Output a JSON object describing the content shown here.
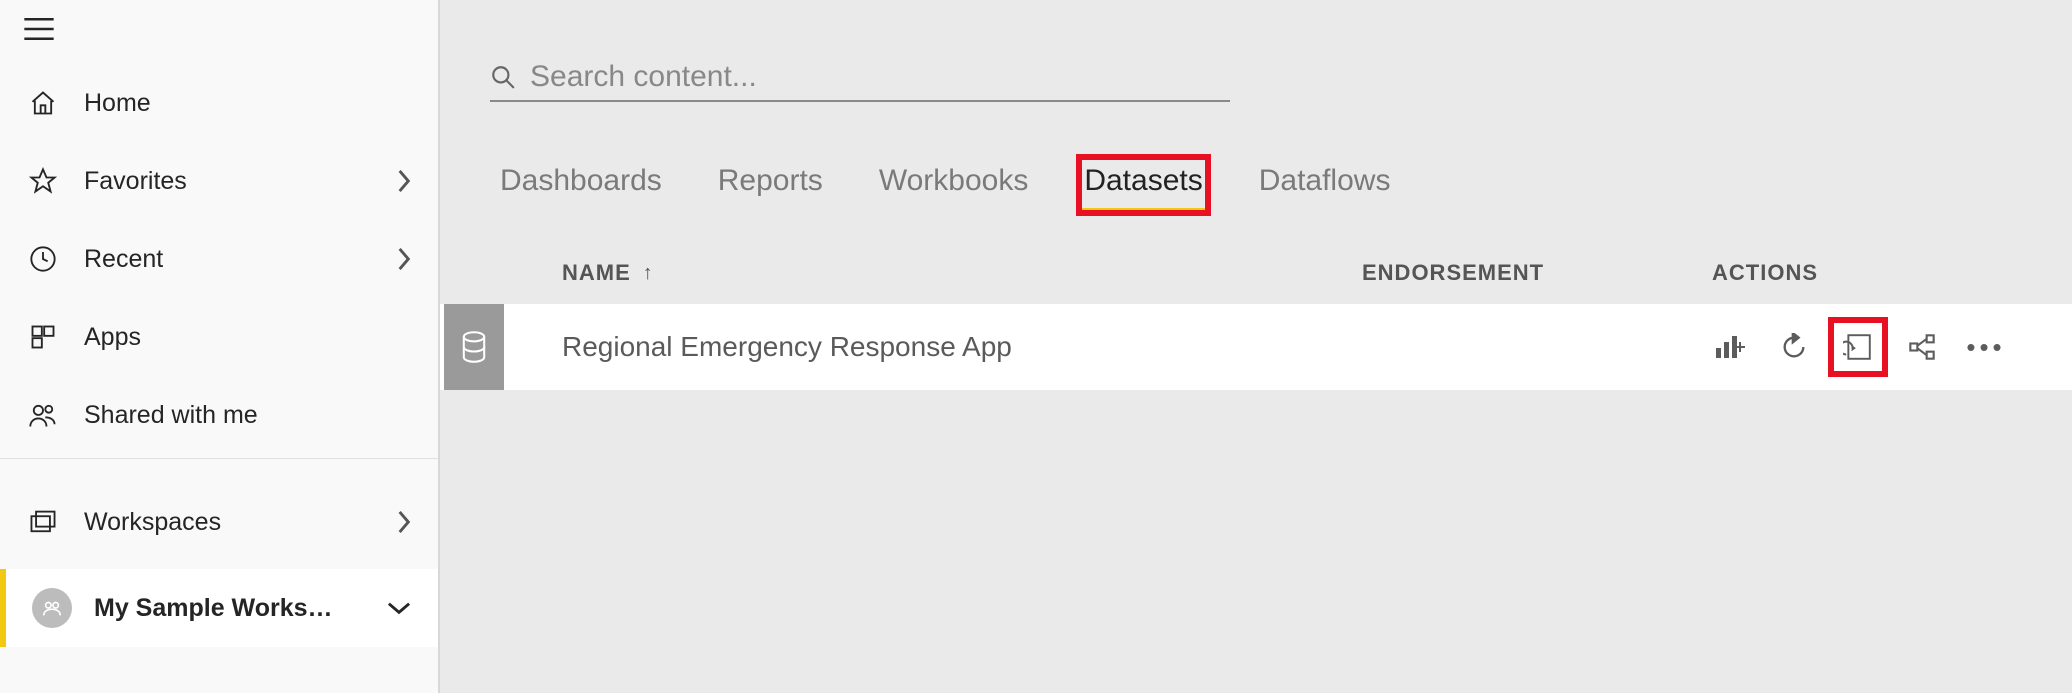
{
  "sidebar": {
    "items": [
      {
        "label": "Home"
      },
      {
        "label": "Favorites"
      },
      {
        "label": "Recent"
      },
      {
        "label": "Apps"
      },
      {
        "label": "Shared with me"
      },
      {
        "label": "Workspaces"
      }
    ],
    "current_workspace": "My Sample Works…"
  },
  "search": {
    "placeholder": "Search content..."
  },
  "tabs": [
    {
      "label": "Dashboards",
      "active": false
    },
    {
      "label": "Reports",
      "active": false
    },
    {
      "label": "Workbooks",
      "active": false
    },
    {
      "label": "Datasets",
      "active": true,
      "highlighted": true
    },
    {
      "label": "Dataflows",
      "active": false
    }
  ],
  "columns": {
    "name": "NAME",
    "endorsement": "ENDORSEMENT",
    "actions": "ACTIONS"
  },
  "rows": [
    {
      "name": "Regional Emergency Response App",
      "endorsement": ""
    }
  ],
  "row_action_names": {
    "create_report": "create-report",
    "refresh": "refresh-now",
    "schedule_refresh": "schedule-refresh",
    "share": "share",
    "more": "more-options"
  }
}
